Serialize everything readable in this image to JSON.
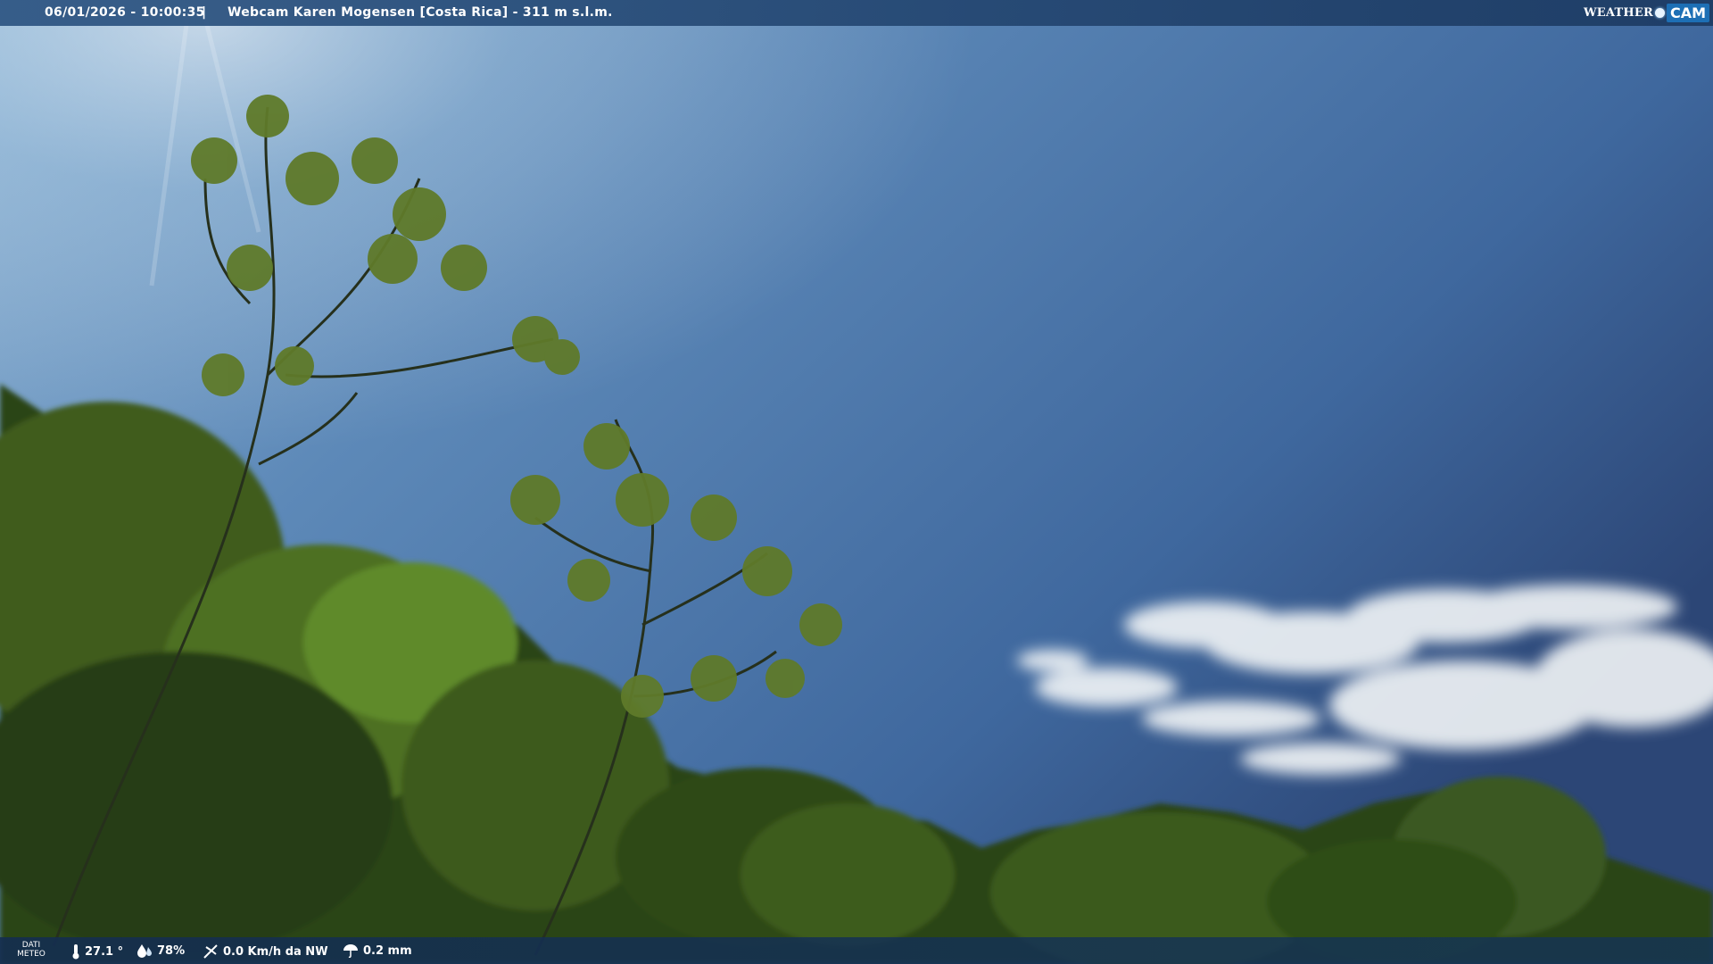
{
  "header": {
    "timestamp": "06/01/2026 - 10:00:35",
    "separator": "|",
    "title": "Webcam Karen Mogensen [Costa Rica] - 311 m s.l.m.",
    "brand_weather": "WEATHER",
    "brand_cam": "CAM"
  },
  "footer": {
    "dati_line1": "DATI",
    "dati_line2": "METEO",
    "temperature": "27.1 °",
    "humidity": "78%",
    "wind": "0.0 Km/h da NW",
    "rain": "0.2 mm"
  },
  "icons": [
    "thermometer-icon",
    "humidity-icon",
    "wind-icon",
    "rain-icon",
    "weathercam-logo"
  ],
  "colors": {
    "sky_top": "#7fa6c8",
    "sky_dark": "#2e4a78",
    "foliage": "#2f4a1c"
  }
}
